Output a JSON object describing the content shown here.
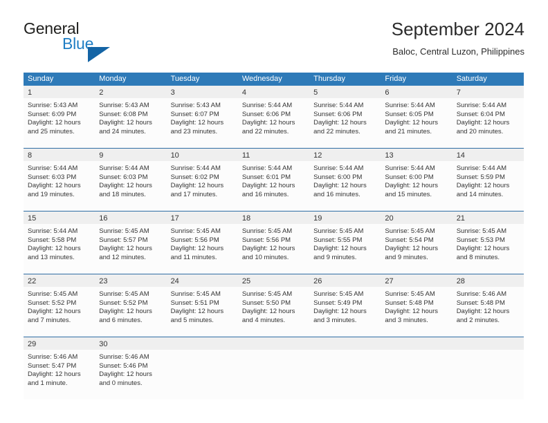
{
  "brand": {
    "name_part1": "General",
    "name_part2": "Blue",
    "triangle_color": "#1464a5"
  },
  "header": {
    "month_title": "September 2024",
    "location": "Baloc, Central Luzon, Philippines"
  },
  "theme": {
    "header_blue": "#2e7ab8",
    "row_divider": "#2e6da4",
    "day_band_gray": "#efefef",
    "cell_background": "#fcfcfc"
  },
  "weekdays": [
    "Sunday",
    "Monday",
    "Tuesday",
    "Wednesday",
    "Thursday",
    "Friday",
    "Saturday"
  ],
  "weeks": [
    [
      {
        "day": "1",
        "sunrise": "Sunrise: 5:43 AM",
        "sunset": "Sunset: 6:09 PM",
        "daylight": "Daylight: 12 hours and 25 minutes."
      },
      {
        "day": "2",
        "sunrise": "Sunrise: 5:43 AM",
        "sunset": "Sunset: 6:08 PM",
        "daylight": "Daylight: 12 hours and 24 minutes."
      },
      {
        "day": "3",
        "sunrise": "Sunrise: 5:43 AM",
        "sunset": "Sunset: 6:07 PM",
        "daylight": "Daylight: 12 hours and 23 minutes."
      },
      {
        "day": "4",
        "sunrise": "Sunrise: 5:44 AM",
        "sunset": "Sunset: 6:06 PM",
        "daylight": "Daylight: 12 hours and 22 minutes."
      },
      {
        "day": "5",
        "sunrise": "Sunrise: 5:44 AM",
        "sunset": "Sunset: 6:06 PM",
        "daylight": "Daylight: 12 hours and 22 minutes."
      },
      {
        "day": "6",
        "sunrise": "Sunrise: 5:44 AM",
        "sunset": "Sunset: 6:05 PM",
        "daylight": "Daylight: 12 hours and 21 minutes."
      },
      {
        "day": "7",
        "sunrise": "Sunrise: 5:44 AM",
        "sunset": "Sunset: 6:04 PM",
        "daylight": "Daylight: 12 hours and 20 minutes."
      }
    ],
    [
      {
        "day": "8",
        "sunrise": "Sunrise: 5:44 AM",
        "sunset": "Sunset: 6:03 PM",
        "daylight": "Daylight: 12 hours and 19 minutes."
      },
      {
        "day": "9",
        "sunrise": "Sunrise: 5:44 AM",
        "sunset": "Sunset: 6:03 PM",
        "daylight": "Daylight: 12 hours and 18 minutes."
      },
      {
        "day": "10",
        "sunrise": "Sunrise: 5:44 AM",
        "sunset": "Sunset: 6:02 PM",
        "daylight": "Daylight: 12 hours and 17 minutes."
      },
      {
        "day": "11",
        "sunrise": "Sunrise: 5:44 AM",
        "sunset": "Sunset: 6:01 PM",
        "daylight": "Daylight: 12 hours and 16 minutes."
      },
      {
        "day": "12",
        "sunrise": "Sunrise: 5:44 AM",
        "sunset": "Sunset: 6:00 PM",
        "daylight": "Daylight: 12 hours and 16 minutes."
      },
      {
        "day": "13",
        "sunrise": "Sunrise: 5:44 AM",
        "sunset": "Sunset: 6:00 PM",
        "daylight": "Daylight: 12 hours and 15 minutes."
      },
      {
        "day": "14",
        "sunrise": "Sunrise: 5:44 AM",
        "sunset": "Sunset: 5:59 PM",
        "daylight": "Daylight: 12 hours and 14 minutes."
      }
    ],
    [
      {
        "day": "15",
        "sunrise": "Sunrise: 5:44 AM",
        "sunset": "Sunset: 5:58 PM",
        "daylight": "Daylight: 12 hours and 13 minutes."
      },
      {
        "day": "16",
        "sunrise": "Sunrise: 5:45 AM",
        "sunset": "Sunset: 5:57 PM",
        "daylight": "Daylight: 12 hours and 12 minutes."
      },
      {
        "day": "17",
        "sunrise": "Sunrise: 5:45 AM",
        "sunset": "Sunset: 5:56 PM",
        "daylight": "Daylight: 12 hours and 11 minutes."
      },
      {
        "day": "18",
        "sunrise": "Sunrise: 5:45 AM",
        "sunset": "Sunset: 5:56 PM",
        "daylight": "Daylight: 12 hours and 10 minutes."
      },
      {
        "day": "19",
        "sunrise": "Sunrise: 5:45 AM",
        "sunset": "Sunset: 5:55 PM",
        "daylight": "Daylight: 12 hours and 9 minutes."
      },
      {
        "day": "20",
        "sunrise": "Sunrise: 5:45 AM",
        "sunset": "Sunset: 5:54 PM",
        "daylight": "Daylight: 12 hours and 9 minutes."
      },
      {
        "day": "21",
        "sunrise": "Sunrise: 5:45 AM",
        "sunset": "Sunset: 5:53 PM",
        "daylight": "Daylight: 12 hours and 8 minutes."
      }
    ],
    [
      {
        "day": "22",
        "sunrise": "Sunrise: 5:45 AM",
        "sunset": "Sunset: 5:52 PM",
        "daylight": "Daylight: 12 hours and 7 minutes."
      },
      {
        "day": "23",
        "sunrise": "Sunrise: 5:45 AM",
        "sunset": "Sunset: 5:52 PM",
        "daylight": "Daylight: 12 hours and 6 minutes."
      },
      {
        "day": "24",
        "sunrise": "Sunrise: 5:45 AM",
        "sunset": "Sunset: 5:51 PM",
        "daylight": "Daylight: 12 hours and 5 minutes."
      },
      {
        "day": "25",
        "sunrise": "Sunrise: 5:45 AM",
        "sunset": "Sunset: 5:50 PM",
        "daylight": "Daylight: 12 hours and 4 minutes."
      },
      {
        "day": "26",
        "sunrise": "Sunrise: 5:45 AM",
        "sunset": "Sunset: 5:49 PM",
        "daylight": "Daylight: 12 hours and 3 minutes."
      },
      {
        "day": "27",
        "sunrise": "Sunrise: 5:45 AM",
        "sunset": "Sunset: 5:48 PM",
        "daylight": "Daylight: 12 hours and 3 minutes."
      },
      {
        "day": "28",
        "sunrise": "Sunrise: 5:46 AM",
        "sunset": "Sunset: 5:48 PM",
        "daylight": "Daylight: 12 hours and 2 minutes."
      }
    ],
    [
      {
        "day": "29",
        "sunrise": "Sunrise: 5:46 AM",
        "sunset": "Sunset: 5:47 PM",
        "daylight": "Daylight: 12 hours and 1 minute."
      },
      {
        "day": "30",
        "sunrise": "Sunrise: 5:46 AM",
        "sunset": "Sunset: 5:46 PM",
        "daylight": "Daylight: 12 hours and 0 minutes."
      },
      {
        "day": "",
        "sunrise": "",
        "sunset": "",
        "daylight": ""
      },
      {
        "day": "",
        "sunrise": "",
        "sunset": "",
        "daylight": ""
      },
      {
        "day": "",
        "sunrise": "",
        "sunset": "",
        "daylight": ""
      },
      {
        "day": "",
        "sunrise": "",
        "sunset": "",
        "daylight": ""
      },
      {
        "day": "",
        "sunrise": "",
        "sunset": "",
        "daylight": ""
      }
    ]
  ]
}
